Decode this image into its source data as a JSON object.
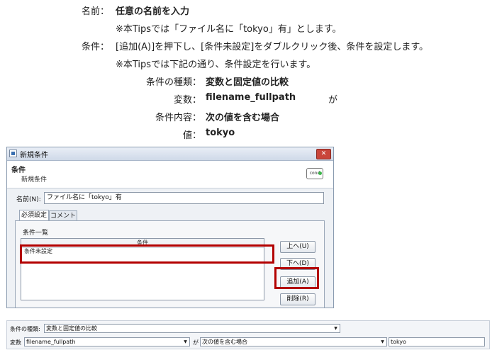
{
  "instructions": {
    "name_label": "名前：",
    "name_value": "任意の名前を入力",
    "name_note": "※本Tipsでは「ファイル名に「tokyo」有」とします。",
    "cond_label": "条件：",
    "cond_value": "[追加(A)]を押下し、[条件未設定]をダブルクリック後、条件を設定します。",
    "cond_note": "※本Tipsでは下記の通り、条件設定を行います。",
    "kind_label": "条件の種類：",
    "kind_value": "変数と固定値の比較",
    "var_label": "変数：",
    "var_value": "filename_fullpath",
    "var_suffix": "が",
    "content_label": "条件内容：",
    "content_value": "次の値を含む場合",
    "val_label": "値：",
    "val_value": "tokyo"
  },
  "dialog": {
    "title": "新規条件",
    "close_glyph": "✕",
    "header_title": "条件",
    "header_subtitle": "新規条件",
    "logo_text": "cond",
    "name_field_label": "名前(N):",
    "name_field_value": "ファイル名に「tokyo」有",
    "tabs": [
      {
        "label": "必須設定",
        "active": true
      },
      {
        "label": "コメント",
        "active": false
      }
    ],
    "list_label": "条件一覧",
    "list_column": "条件",
    "list_items": [
      "条件未設定"
    ],
    "buttons": {
      "up": "上へ(U)",
      "down": "下へ(D)",
      "add": "追加(A)",
      "delete": "削除(R)"
    }
  },
  "condition_editor": {
    "kind_label": "条件の種類:",
    "kind_value": "変数と固定値の比較",
    "var_label": "変数",
    "var_value": "filename_fullpath",
    "ga_label": "が",
    "content_value": "次の値を含む場合",
    "value_text": "tokyo",
    "dropdown_glyph": "▼"
  },
  "colors": {
    "highlight": "#b30000",
    "close_button": "#c9453a"
  }
}
